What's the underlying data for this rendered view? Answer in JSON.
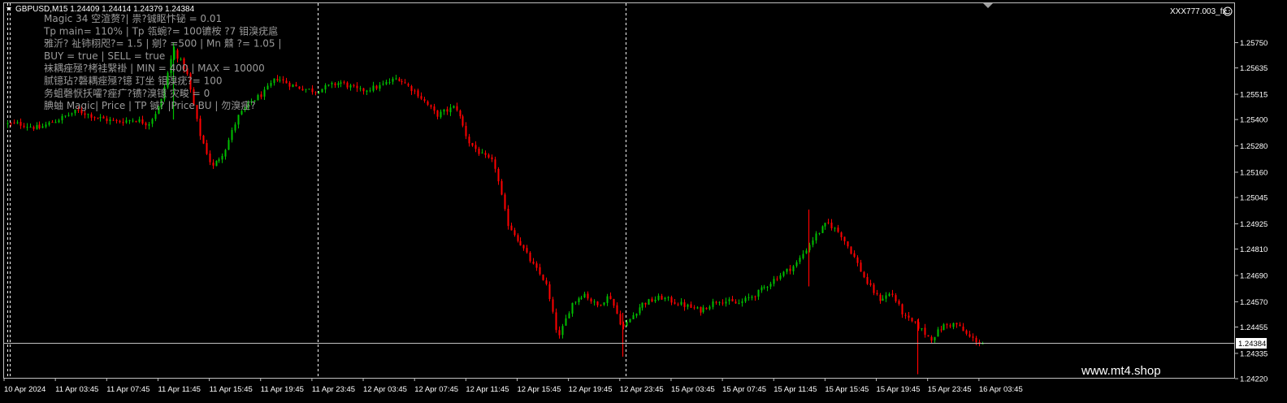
{
  "header": {
    "symbol_line": "GBPUSD,M15  1.24409 1.24414 1.24379 1.24384",
    "account_label": "XXX777.003_fx"
  },
  "overlay_lines": [
    "Magic  34                    空渲赘?|  祟?铖眍忭铋  = 0.01",
    "Tp main= 110% | Tp 瓴蜿?= 100镳桉 ?7 钼溴疣扈",
    "雅沂? 祉铈栩咫?= 1.5 | 剜? =500 | Mn 鼘    ?= 1.05 |",
    "  BUY    = true    |  SELL  =  true",
    "袜耦痤殛?栲袿繄褂 | MIN = 400  |  MAX = 10000",
    "腻镱玷?磬耦痤殛?镱 玎坐      钼溴疣?= 100",
    "务蛆磬恹扷嚯?痤疒?镄?溴镱 灾畯       = 0",
    "腆蚰  Magic|  Price    | TP 铖?   |Price BU | 勿溴痤?"
  ],
  "watermark": "www.mt4.shop",
  "colors": {
    "background": "#000000",
    "bull": "#00c000",
    "bear": "#ff0000",
    "bid_line": "#c0c0c0",
    "separator": "#ffffff",
    "text": "#ffffff",
    "overlay": "#9a9a9a"
  },
  "chart_data": {
    "type": "candlestick",
    "symbol": "GBPUSD",
    "timeframe": "M15",
    "ohlc_header": {
      "open": 1.24409,
      "high": 1.24414,
      "low": 1.24379,
      "close": 1.24384
    },
    "current_price": "1.24384",
    "ylim": [
      1.2422,
      1.258
    ],
    "y_ticks": [
      "1.25750",
      "1.25635",
      "1.25515",
      "1.25400",
      "1.25280",
      "1.25160",
      "1.25045",
      "1.24925",
      "1.24810",
      "1.24690",
      "1.24570",
      "1.24455",
      "1.24335",
      "1.24220"
    ],
    "x_ticks": [
      "10 Apr 2024",
      "11 Apr 03:45",
      "11 Apr 07:45",
      "11 Apr 11:45",
      "11 Apr 15:45",
      "11 Apr 19:45",
      "11 Apr 23:45",
      "12 Apr 03:45",
      "12 Apr 07:45",
      "12 Apr 11:45",
      "12 Apr 15:45",
      "12 Apr 19:45",
      "12 Apr 23:45",
      "15 Apr 03:45",
      "15 Apr 07:45",
      "15 Apr 11:45",
      "15 Apr 15:45",
      "15 Apr 19:45",
      "15 Apr 23:45",
      "16 Apr 03:45"
    ],
    "day_separators": [
      "11 Apr 00:00",
      "12 Apr 00:00",
      "15 Apr 00:00"
    ],
    "close_path": [
      [
        "10 Apr 21:30",
        1.2534
      ],
      [
        "10 Apr 23:00",
        1.2538
      ],
      [
        "11 Apr 01:00",
        1.2538
      ],
      [
        "11 Apr 02:30",
        1.2536
      ],
      [
        "11 Apr 04:00",
        1.254
      ],
      [
        "11 Apr 05:30",
        1.2544
      ],
      [
        "11 Apr 07:00",
        1.2541
      ],
      [
        "11 Apr 08:30",
        1.2539
      ],
      [
        "11 Apr 10:00",
        1.254
      ],
      [
        "11 Apr 11:00",
        1.2538
      ],
      [
        "11 Apr 12:00",
        1.2547
      ],
      [
        "11 Apr 13:00",
        1.2572
      ],
      [
        "11 Apr 14:00",
        1.2562
      ],
      [
        "11 Apr 15:00",
        1.2534
      ],
      [
        "11 Apr 16:00",
        1.2518
      ],
      [
        "11 Apr 17:00",
        1.2526
      ],
      [
        "11 Apr 18:00",
        1.2541
      ],
      [
        "11 Apr 19:00",
        1.2548
      ],
      [
        "11 Apr 20:00",
        1.2552
      ],
      [
        "11 Apr 21:00",
        1.2559
      ],
      [
        "11 Apr 22:30",
        1.2555
      ],
      [
        "12 Apr 00:00",
        1.2553
      ],
      [
        "12 Apr 02:00",
        1.2557
      ],
      [
        "12 Apr 03:30",
        1.2553
      ],
      [
        "12 Apr 05:00",
        1.2555
      ],
      [
        "12 Apr 06:30",
        1.2559
      ],
      [
        "12 Apr 08:00",
        1.2552
      ],
      [
        "12 Apr 09:30",
        1.2542
      ],
      [
        "12 Apr 11:00",
        1.2546
      ],
      [
        "12 Apr 12:00",
        1.253
      ],
      [
        "12 Apr 13:00",
        1.2524
      ],
      [
        "12 Apr 14:00",
        1.252
      ],
      [
        "12 Apr 15:00",
        1.2493
      ],
      [
        "12 Apr 16:00",
        1.2484
      ],
      [
        "12 Apr 17:00",
        1.2474
      ],
      [
        "12 Apr 18:00",
        1.2466
      ],
      [
        "12 Apr 19:00",
        1.244
      ],
      [
        "12 Apr 20:00",
        1.2456
      ],
      [
        "12 Apr 21:00",
        1.2461
      ],
      [
        "12 Apr 22:00",
        1.2455
      ],
      [
        "12 Apr 23:00",
        1.246
      ],
      [
        "15 Apr 00:00",
        1.2445
      ],
      [
        "15 Apr 01:30",
        1.2456
      ],
      [
        "15 Apr 03:00",
        1.2459
      ],
      [
        "15 Apr 04:30",
        1.2456
      ],
      [
        "15 Apr 06:00",
        1.2453
      ],
      [
        "15 Apr 07:30",
        1.2458
      ],
      [
        "15 Apr 09:00",
        1.2456
      ],
      [
        "15 Apr 10:30",
        1.2461
      ],
      [
        "15 Apr 12:00",
        1.2468
      ],
      [
        "15 Apr 13:30",
        1.2474
      ],
      [
        "15 Apr 15:00",
        1.2487
      ],
      [
        "15 Apr 16:00",
        1.2493
      ],
      [
        "15 Apr 17:00",
        1.2488
      ],
      [
        "15 Apr 18:00",
        1.2478
      ],
      [
        "15 Apr 19:00",
        1.2466
      ],
      [
        "15 Apr 20:00",
        1.2458
      ],
      [
        "15 Apr 21:00",
        1.2461
      ],
      [
        "15 Apr 22:00",
        1.245
      ],
      [
        "15 Apr 23:00",
        1.2446
      ],
      [
        "16 Apr 00:00",
        1.244
      ],
      [
        "16 Apr 01:00",
        1.2446
      ],
      [
        "16 Apr 02:00",
        1.2447
      ],
      [
        "16 Apr 03:00",
        1.2441
      ],
      [
        "16 Apr 04:00",
        1.2438
      ]
    ]
  }
}
